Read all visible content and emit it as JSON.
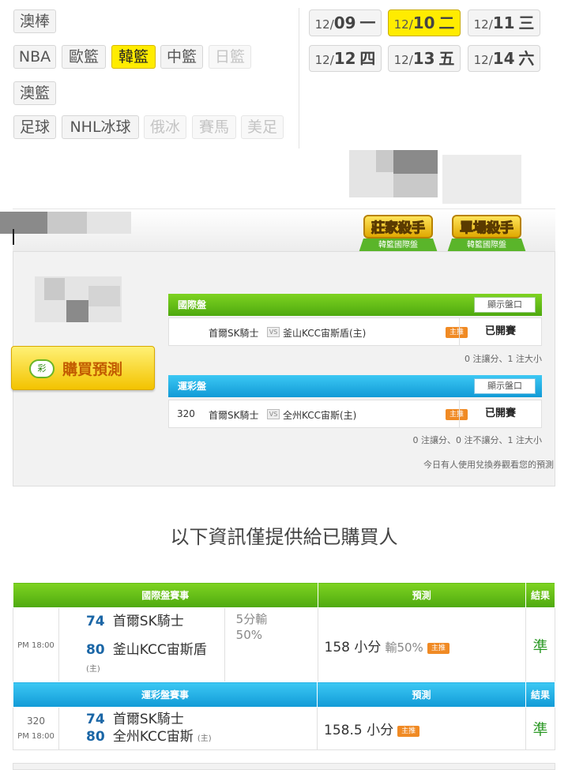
{
  "sports": {
    "row1": [
      {
        "label": "澳棒",
        "state": "normal"
      }
    ],
    "row2": [
      {
        "label": "NBA",
        "state": "normal"
      },
      {
        "label": "歐籃",
        "state": "normal"
      },
      {
        "label": "韓籃",
        "state": "active"
      },
      {
        "label": "中籃",
        "state": "normal"
      },
      {
        "label": "日籃",
        "state": "disabled"
      }
    ],
    "row3": [
      {
        "label": "澳籃",
        "state": "normal"
      }
    ],
    "row4": [
      {
        "label": "足球",
        "state": "normal"
      },
      {
        "label": "NHL冰球",
        "state": "normal"
      },
      {
        "label": "俄冰",
        "state": "disabled"
      },
      {
        "label": "賽馬",
        "state": "disabled"
      },
      {
        "label": "美足",
        "state": "disabled"
      }
    ]
  },
  "dates": [
    {
      "month": "12/",
      "day": "09",
      "weekday": "一",
      "active": false
    },
    {
      "month": "12/",
      "day": "10",
      "weekday": "二",
      "active": true
    },
    {
      "month": "12/",
      "day": "11",
      "weekday": "三",
      "active": false
    },
    {
      "month": "12/",
      "day": "12",
      "weekday": "四",
      "active": false
    },
    {
      "month": "12/",
      "day": "13",
      "weekday": "五",
      "active": false
    },
    {
      "month": "12/",
      "day": "14",
      "weekday": "六",
      "active": false
    }
  ],
  "badges": [
    {
      "title": "莊家殺手",
      "ribbon": "韓籃國際盤"
    },
    {
      "title": "單場殺手",
      "ribbon": "韓籃國際盤"
    }
  ],
  "buy_button": {
    "coin": "彩",
    "label": "購買預測"
  },
  "intl": {
    "title": "國際盤",
    "show_label": "顯示盤口",
    "num": "",
    "home": "首爾SK騎士",
    "vs": "VS",
    "away": "釜山KCC宙斯盾(主)",
    "tag": "主推",
    "status": "已開賽",
    "summary": "0 注讓分、1 注大小"
  },
  "sport_lottery": {
    "title": "運彩盤",
    "show_label": "顯示盤口",
    "num": "320",
    "home": "首爾SK騎士",
    "vs": "VS",
    "away": "全州KCC宙斯(主)",
    "tag": "主推",
    "status": "已開賽",
    "summary": "0 注讓分、0 注不讓分、1 注大小",
    "exchange_note": "今日有人使用兌換券觀看您的預測"
  },
  "notice": "以下資訊僅提供給已購買人",
  "result_intl": {
    "headers": [
      "國際盤賽事",
      "預測",
      "結果"
    ],
    "time": "PM 18:00",
    "num": "",
    "score1": "74",
    "team1": "首爾SK騎士",
    "score2": "80",
    "team2": "釜山KCC宙斯盾",
    "host_mark": "(主)",
    "line1": "5分輸",
    "line2": "50%",
    "pred_value": "158 小分",
    "pred_extra": "輸50%",
    "tag": "主推",
    "result": "準"
  },
  "result_lottery": {
    "headers": [
      "運彩盤賽事",
      "預測",
      "結果"
    ],
    "time": "PM 18:00",
    "num": "320",
    "score1": "74",
    "team1": "首爾SK騎士",
    "score2": "80",
    "team2": "全州KCC宙斯",
    "host_mark": "(主)",
    "pred_value": "158.5 小分",
    "tag": "主推",
    "result": "準"
  }
}
